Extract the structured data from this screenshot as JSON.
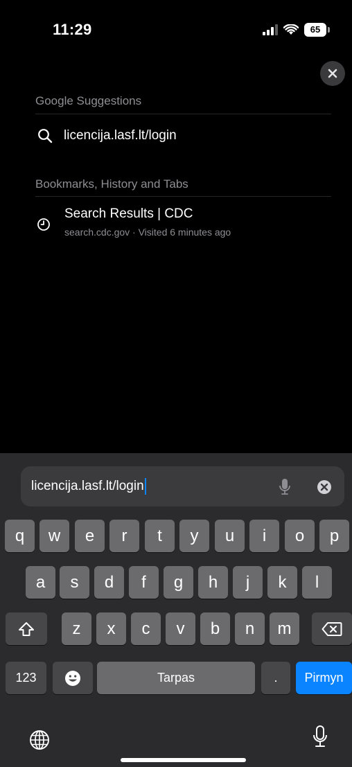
{
  "status_bar": {
    "time": "11:29",
    "battery": "65"
  },
  "suggestions": {
    "google_header": "Google Suggestions",
    "google_item": "licencija.lasf.lt/login",
    "history_header": "Bookmarks, History and Tabs",
    "history_item_title": "Search Results | CDC",
    "history_item_sub": "search.cdc.gov · Visited 6 minutes ago"
  },
  "address_bar": {
    "value": "licencija.lasf.lt/login"
  },
  "keyboard": {
    "row1": [
      "q",
      "w",
      "e",
      "r",
      "t",
      "y",
      "u",
      "i",
      "o",
      "p"
    ],
    "row2": [
      "a",
      "s",
      "d",
      "f",
      "g",
      "h",
      "j",
      "k",
      "l"
    ],
    "row3": [
      "z",
      "x",
      "c",
      "v",
      "b",
      "n",
      "m"
    ],
    "numbers_label": "123",
    "space_label": "Tarpas",
    "period_label": ".",
    "go_label": "Pirmyn"
  }
}
